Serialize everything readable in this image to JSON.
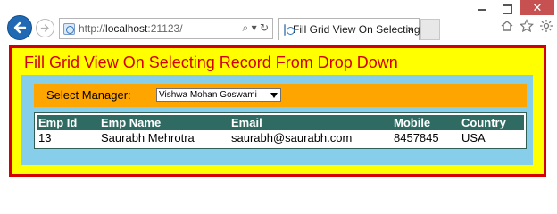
{
  "browser": {
    "address_host": "http://",
    "address_bold": "localhost",
    "address_rest": ":21123/",
    "address_tools": "⌕ ▾ ↻",
    "tab_title": "Fill Grid View On Selecting ...",
    "tab_close": "×",
    "window_close": "✕",
    "right_icons": [
      "home-icon",
      "star-icon",
      "gear-icon"
    ]
  },
  "page": {
    "title": "Fill Grid View On Selecting Record From Drop Down",
    "manager_label": "Select Manager:",
    "manager_selected": "Vishwa Mohan Goswami",
    "grid": {
      "columns": [
        "Emp Id",
        "Emp Name",
        "Email",
        "Mobile",
        "Country"
      ],
      "rows": [
        [
          "13",
          "Saurabh Mehrotra",
          "saurabh@saurabh.com",
          "8457845",
          "USA"
        ]
      ]
    }
  },
  "colors": {
    "frame_bg": "#ffff00",
    "frame_border": "#d40000",
    "panel_bg": "#87ceeb",
    "manager_row_bg": "#ffa500",
    "grid_header_bg": "#2f6b62"
  }
}
